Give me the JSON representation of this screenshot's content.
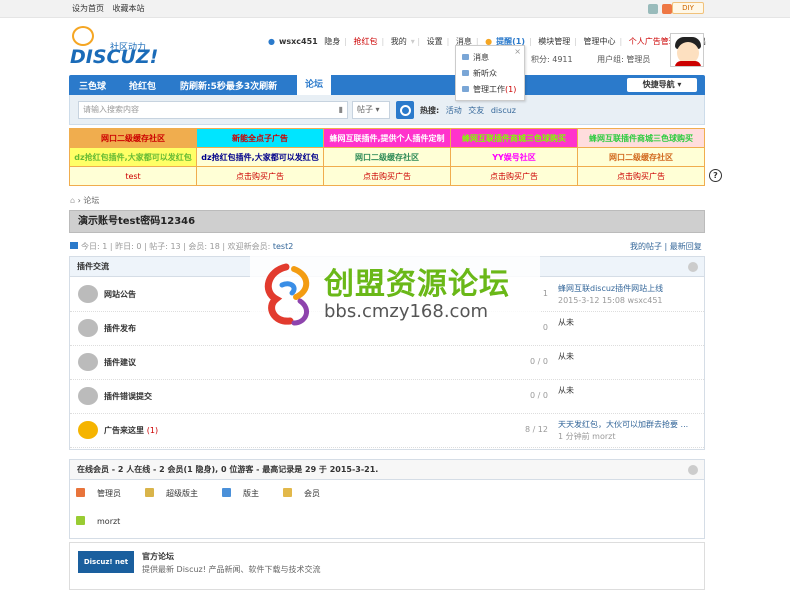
{
  "topbar": {
    "set_home": "设为首页",
    "bookmark": "收藏本站",
    "diy": "DIY"
  },
  "header": {
    "logo_word": "DISCUZ!",
    "logo_tag": "社区动力",
    "username": "wsxc451",
    "invisible": "隐身",
    "qianghongbao": "抢红包",
    "my": "我的",
    "settings": "设置",
    "messages": "消息",
    "remind": "提醒(1)",
    "module_manage": "模块管理",
    "manage_center": "管理中心",
    "personal_ad": "个人广告管理",
    "logout": "退出",
    "points": "积分: 4911",
    "usergroup": "用户组: 管理员"
  },
  "popup": {
    "items": [
      "消息",
      "新听众",
      "管理工作"
    ],
    "manage_count": "(1)"
  },
  "navbar": {
    "items": [
      "三色球",
      "抢红包",
      "防刷新:5秒最多3次刷新",
      "论坛"
    ],
    "quick": "快捷导航"
  },
  "search": {
    "placeholder": "请输入搜索内容",
    "type": "帖子",
    "hot_label": "热搜:",
    "hot": [
      "活动",
      "交友",
      "discuz"
    ]
  },
  "ads": {
    "rows": [
      [
        {
          "t": "网口二级缓存社区",
          "bg": "#f0ad4e",
          "c": "#c00"
        },
        {
          "t": "新能全点子广告",
          "bg": "#00e5ff",
          "c": "#c00"
        },
        {
          "t": "蜂网互联插件,提供个人插件定制",
          "bg": "#ff33cc",
          "c": "#fff"
        },
        {
          "t": "蜂网互联插件商城三色球购买",
          "bg": "#ff33cc",
          "c": "#7fff00"
        },
        {
          "t": "蜂网互联插件商城三色球购买",
          "bg": "#ffdddd",
          "c": "#2ecc40"
        }
      ],
      [
        {
          "t": "dz抢红包插件,大家都可以发红包",
          "bg": "#ffff66",
          "c": "#6b3"
        },
        {
          "t": "dz抢红包插件,大家都可以发红包",
          "bg": "#ffffd6",
          "c": "#00008b"
        },
        {
          "t": "网口二级缓存社区",
          "bg": "#ffffd6",
          "c": "#2e8b57"
        },
        {
          "t": "YY娱号社区",
          "bg": "#ffffd6",
          "c": "#ff00ff"
        },
        {
          "t": "网口二级缓存社区",
          "bg": "#ffffd6",
          "c": "#d2691e"
        }
      ],
      [
        {
          "t": "test",
          "bg": "#ffffd6",
          "c": "#c00"
        },
        {
          "t": "点击购买广告",
          "bg": "#ffffd6",
          "c": "#c00"
        },
        {
          "t": "点击购买广告",
          "bg": "#ffffd6",
          "c": "#c00"
        },
        {
          "t": "点击购买广告",
          "bg": "#ffffd6",
          "c": "#c00"
        },
        {
          "t": "点击购买广告",
          "bg": "#ffffd6",
          "c": "#c00"
        }
      ]
    ]
  },
  "help": "?",
  "breadcrumb": "论坛",
  "title": "演示账号test密码12346",
  "stats": {
    "text": "今日: 1 | 昨日: 0 | 帖子: 13 | 会员: 18 | 欢迎新会员:",
    "newest": "test2",
    "my_posts": "我的帖子",
    "latest_reply": "最新回复"
  },
  "forum_box": {
    "title": "插件交流",
    "forums": [
      {
        "name": "网站公告",
        "count": "",
        "nums": "1",
        "last1": "蜂网互联discuz插件网站上线",
        "last2": "2015-3-12 15:08 wsxc451",
        "new": false
      },
      {
        "name": "插件发布",
        "count": "",
        "nums": "0",
        "last1": "从未",
        "last2": "",
        "new": false
      },
      {
        "name": "插件建议",
        "count": "",
        "nums": "0 / 0",
        "last1": "从未",
        "last2": "",
        "new": false
      },
      {
        "name": "插件错误提交",
        "count": "",
        "nums": "0 / 0",
        "last1": "从未",
        "last2": "",
        "new": false
      },
      {
        "name": "广告来这里",
        "count": "(1)",
        "nums": "8 / 12",
        "last1": "天天发红包，大伙可以加群去抢要 ...",
        "last2": "1 分钟前 morzt",
        "new": true
      }
    ]
  },
  "online": {
    "title": "在线会员 - 2 人在线 - 2 会员(1 隐身), 0 位游客 - 最高记录是 29 于 2015-3-21.",
    "legend": [
      {
        "label": "管理员",
        "color": "#e8743b"
      },
      {
        "label": "超级版主",
        "color": "#d9b44a"
      },
      {
        "label": "版主",
        "color": "#4a90d9"
      },
      {
        "label": "会员",
        "color": "#e2b84a"
      }
    ],
    "users": [
      "morzt"
    ]
  },
  "watermark": {
    "cn": "创盟资源论坛",
    "url": "bbs.cmzy168.com"
  },
  "partner": {
    "logo": "Discuz! net",
    "name": "官方论坛",
    "desc": "提供最新 Discuz! 产品新闻、软件下载与技术交流"
  }
}
